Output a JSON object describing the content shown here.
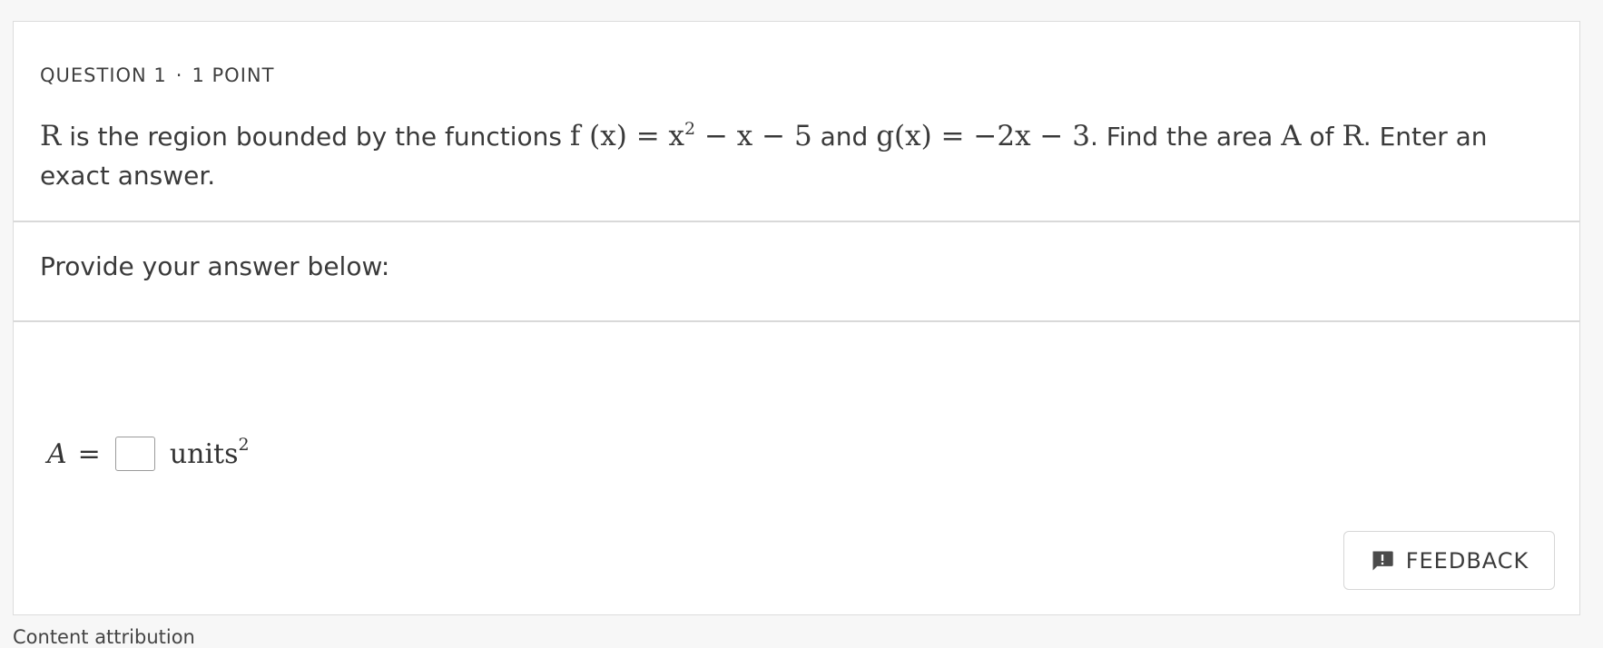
{
  "question": {
    "number_label": "QUESTION 1",
    "separator": "·",
    "points_label": "1 POINT",
    "text_parts": {
      "p1": "R",
      "p2": " is the region bounded by the functions ",
      "p3": "f (x) = x",
      "p3_sup": "2",
      "p4": " − x − 5",
      "p5": " and ",
      "p6": "g(x) = −2x − 3",
      "p7": ". Find the area ",
      "p8": "A",
      "p9": " of ",
      "p10": "R",
      "p11": ". Enter an exact answer."
    }
  },
  "prompt": {
    "label": "Provide your answer below:"
  },
  "answer": {
    "variable": "A",
    "equals": "=",
    "value": "",
    "units": "units",
    "units_sup": "2"
  },
  "feedback_button": {
    "label": "FEEDBACK",
    "icon": "feedback-exclamation-icon"
  },
  "footer": {
    "text": "Content attribution"
  },
  "colors": {
    "page_background": "#f7f7f7",
    "card_background": "#ffffff",
    "border": "#d9d9d9",
    "text": "#3a3a3a"
  }
}
